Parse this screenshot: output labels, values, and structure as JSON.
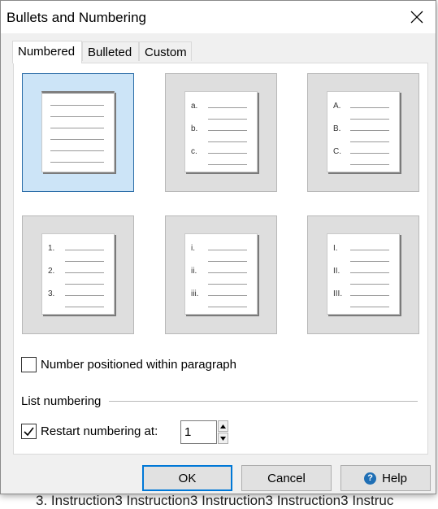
{
  "background_document": {
    "visible_text": "3.     Instruction3 Instruction3 Instruction3 Instruction3 Instruc"
  },
  "dialog": {
    "title": "Bullets and Numbering",
    "tabs": [
      {
        "label": "Numbered",
        "active": true
      },
      {
        "label": "Bulleted",
        "active": false
      },
      {
        "label": "Custom",
        "active": false
      }
    ],
    "styles": [
      {
        "name": "none",
        "markers": [],
        "selected": true
      },
      {
        "name": "lower-alpha",
        "markers": [
          "a.",
          "b.",
          "c."
        ],
        "selected": false
      },
      {
        "name": "upper-alpha",
        "markers": [
          "A.",
          "B.",
          "C."
        ],
        "selected": false
      },
      {
        "name": "decimal",
        "markers": [
          "1.",
          "2.",
          "3."
        ],
        "selected": false
      },
      {
        "name": "lower-roman",
        "markers": [
          "i.",
          "ii.",
          "iii."
        ],
        "selected": false
      },
      {
        "name": "upper-roman",
        "markers": [
          "I.",
          "II.",
          "III."
        ],
        "selected": false
      }
    ],
    "number_positioned": {
      "label": "Number positioned within paragraph",
      "checked": false
    },
    "list_numbering": {
      "group_label": "List numbering",
      "restart_label": "Restart numbering at:",
      "restart_checked": true,
      "restart_value": "1"
    },
    "buttons": {
      "ok": "OK",
      "cancel": "Cancel",
      "help": "Help"
    }
  },
  "colors": {
    "selected_tile": "#cce4f7",
    "selected_border": "#2b6da8",
    "default_button_border": "#0078d7",
    "help_icon": "#1f6fb5"
  }
}
